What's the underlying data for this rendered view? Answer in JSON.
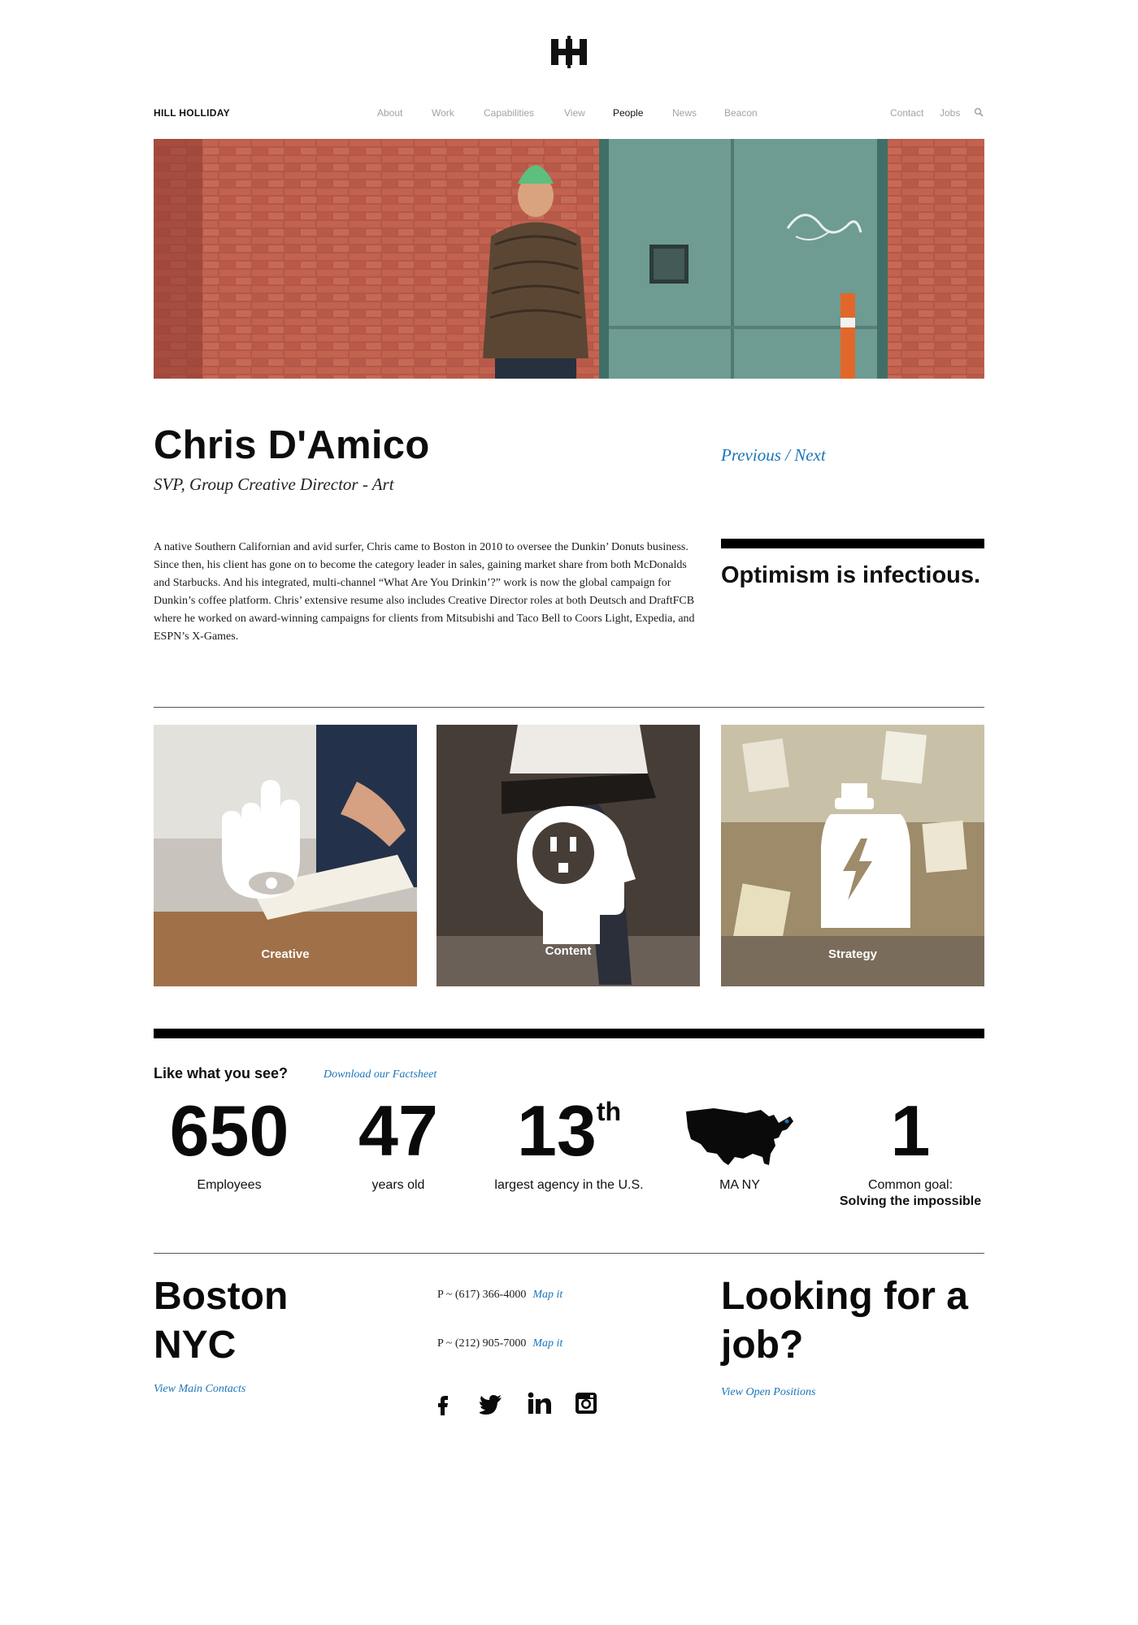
{
  "brand": "HILL HOLLIDAY",
  "nav": {
    "items": [
      {
        "label": "About",
        "active": false
      },
      {
        "label": "Work",
        "active": false
      },
      {
        "label": "Capabilities",
        "active": false
      },
      {
        "label": "View",
        "active": false
      },
      {
        "label": "People",
        "active": true
      },
      {
        "label": "News",
        "active": false
      },
      {
        "label": "Beacon",
        "active": false
      }
    ],
    "contact": "Contact",
    "jobs": "Jobs",
    "search_icon": "search-icon"
  },
  "person": {
    "name": "Chris D'Amico",
    "role": "SVP, Group Creative Director - Art",
    "previous": "Previous",
    "separator": "/",
    "next": "Next",
    "bio": "A native Southern Californian and avid surfer, Chris came to Boston in 2010 to oversee the Dunkin’ Donuts business. Since then, his client has gone on to become the category leader in sales, gaining market share from both McDonalds and Starbucks. And his integrated, multi-channel “What Are You Drinkin’?” work is now the global campaign for Dunkin’s coffee platform. Chris’ extensive resume also includes Creative Director roles at both Deutsch and DraftFCB where he worked on award-winning campaigns for clients from Mitsubishi and Taco Bell to Coors Light, Expedia, and ESPN’s X-Games.",
    "quote": "Optimism is infectious."
  },
  "capabilities": [
    {
      "label": "Creative",
      "icon": "hand-eye-icon"
    },
    {
      "label": "Content",
      "icon": "head-outlet-icon"
    },
    {
      "label": "Strategy",
      "icon": "bottle-bolt-icon"
    }
  ],
  "stats": {
    "heading": "Like what you see?",
    "factsheet": "Download our Factsheet",
    "employees_num": "650",
    "employees_label": "Employees",
    "years_num": "47",
    "years_label": "years old",
    "rank_num": "13",
    "rank_sup": "th",
    "rank_label": "largest agency in the U.S.",
    "locations": "MA    NY",
    "goal_num": "1",
    "goal_label": "Common goal:",
    "goal_bold": "Solving the impossible"
  },
  "footer": {
    "city1": "Boston",
    "city2": "NYC",
    "main_contacts": "View Main Contacts",
    "phone1": "P ~ (617) 366-4000",
    "phone2": "P ~ (212) 905-7000",
    "map_it": "Map it",
    "job_heading": "Looking for a job?",
    "open_positions": "View Open Positions",
    "social": [
      "facebook-icon",
      "twitter-icon",
      "linkedin-icon",
      "instagram-icon"
    ]
  },
  "colors": {
    "link": "#1a75b9",
    "nav_inactive": "#a3a3a3",
    "text": "#111111"
  }
}
